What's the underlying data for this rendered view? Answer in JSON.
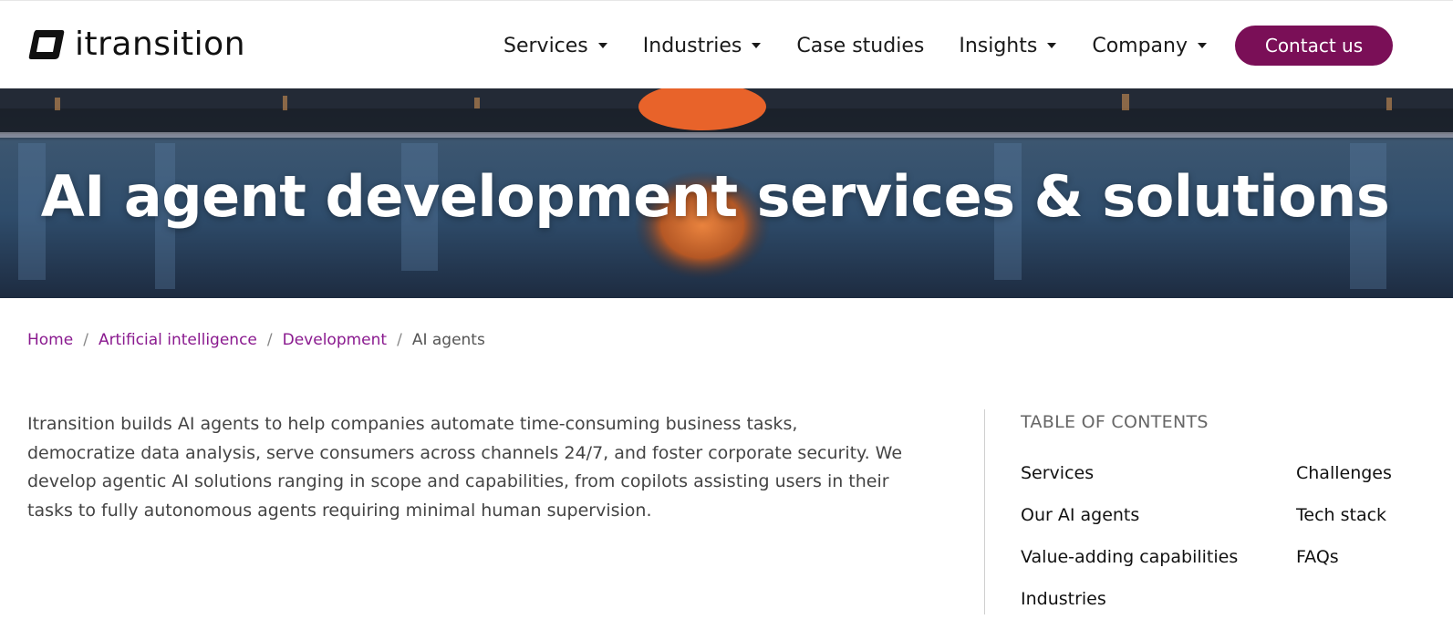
{
  "header": {
    "logo_text": "itransition",
    "nav": [
      {
        "label": "Services",
        "has_dropdown": true
      },
      {
        "label": "Industries",
        "has_dropdown": true
      },
      {
        "label": "Case studies",
        "has_dropdown": false
      },
      {
        "label": "Insights",
        "has_dropdown": true
      },
      {
        "label": "Company",
        "has_dropdown": true
      }
    ],
    "contact_label": "Contact us"
  },
  "hero": {
    "title": "AI agent development services & solutions"
  },
  "breadcrumb": {
    "items": [
      "Home",
      "Artificial intelligence",
      "Development"
    ],
    "current": "AI agents"
  },
  "intro": {
    "text": "Itransition builds AI agents to help companies automate time-consuming business tasks, democratize data analysis, serve consumers across channels 24/7, and foster corporate security. We develop agentic AI solutions ranging in scope and capabilities, from copilots assisting users in their tasks to fully autonomous agents requiring minimal human supervision."
  },
  "toc": {
    "title": "TABLE OF CONTENTS",
    "left": [
      "Services",
      "Our AI agents",
      "Value-adding capabilities",
      "Industries"
    ],
    "right": [
      "Challenges",
      "Tech stack",
      "FAQs"
    ]
  },
  "colors": {
    "accent": "#7a0f57",
    "link": "#8a1a8f"
  }
}
